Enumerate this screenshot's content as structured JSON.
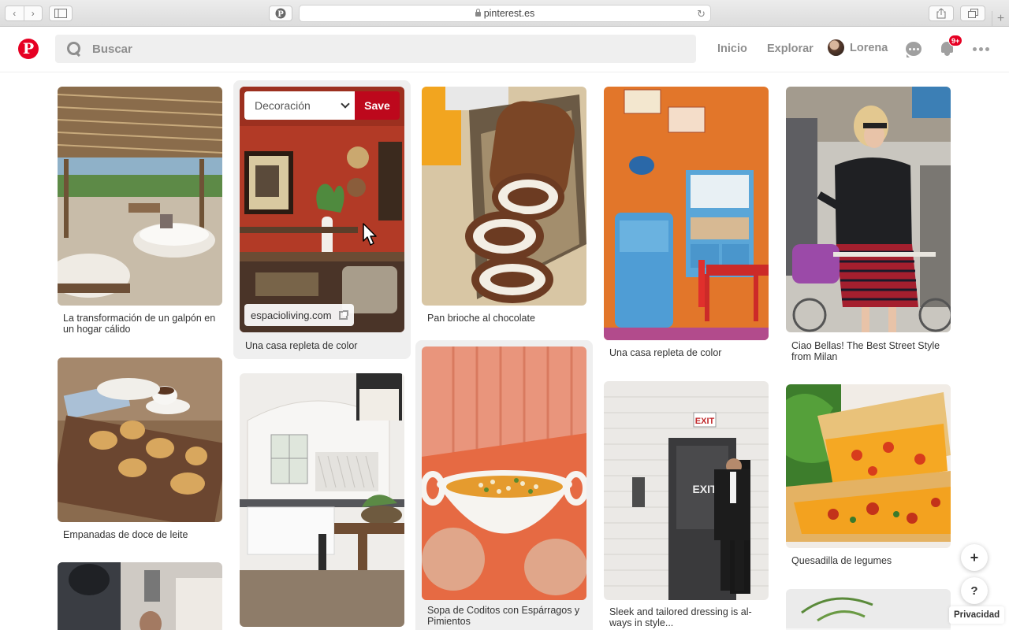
{
  "browser": {
    "url": "pinterest.es",
    "back_glyph": "‹",
    "forward_glyph": "›",
    "reload_glyph": "↻",
    "new_tab_glyph": "+"
  },
  "header": {
    "logo_letter": "P",
    "search_placeholder": "Buscar",
    "nav_home": "Inicio",
    "nav_explore": "Explorar",
    "user_name": "Lorena",
    "notification_badge": "9+"
  },
  "pins": [
    {
      "title": "La transformación de un galpón en un hogar cálido"
    },
    {
      "title": "Una casa repleta de color",
      "board_select": "Decoración",
      "save_label": "Save",
      "link_domain": "espacioliving.com"
    },
    {
      "title": "Pan brioche al chocolate"
    },
    {
      "title": "Una casa repleta de color"
    },
    {
      "title": "Ciao Bellas! The Best Street Style from Milan"
    },
    {
      "title": "Empanadas de doce de leite"
    },
    {
      "title": ""
    },
    {
      "title": "Sopa de Coditos con Espárragos y Pimientos"
    },
    {
      "title": "Sleek and tailored dressing is al-ways in style..."
    },
    {
      "title": "Quesadilla de legumes"
    },
    {
      "title": ""
    },
    {
      "title": ""
    }
  ],
  "fab": {
    "add_glyph": "+",
    "help_glyph": "?",
    "privacy_label": "Privacidad"
  },
  "colors": {
    "brand_red": "#e60023",
    "save_red": "#bd081c",
    "muted_text": "#8e8e8e"
  }
}
